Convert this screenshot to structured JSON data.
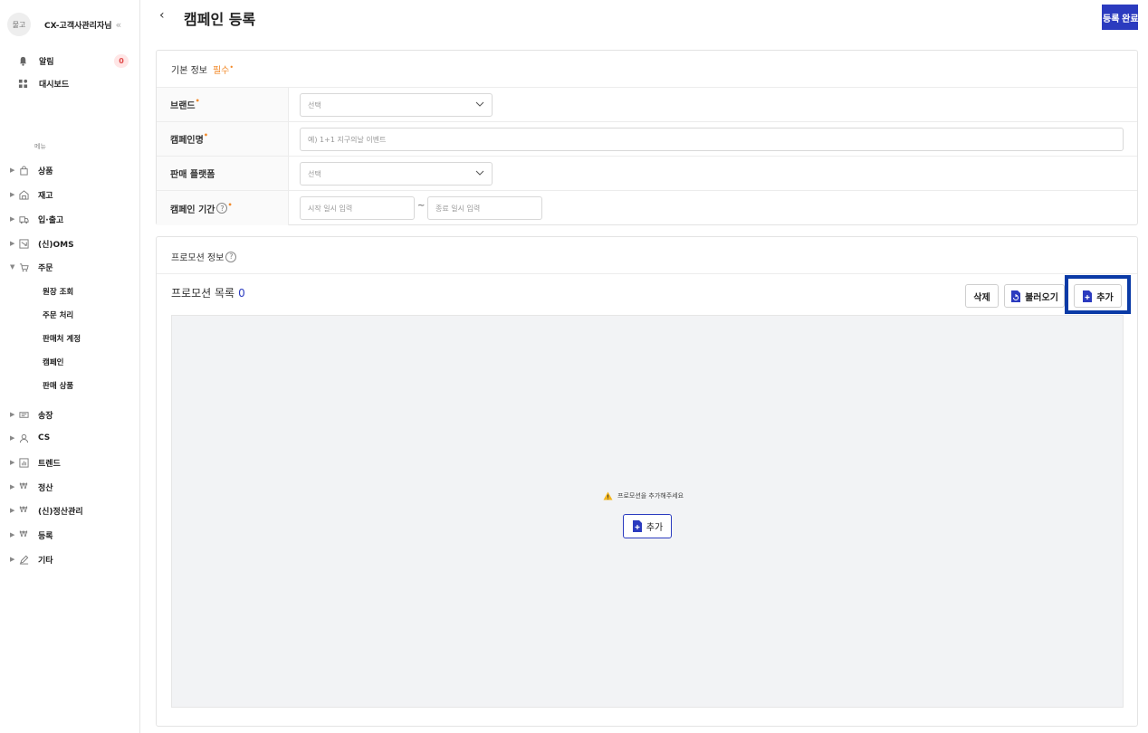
{
  "sidebar": {
    "avatar_text": "물고",
    "user_name": "CX-고객사관리자님",
    "collapse_glyph": "«",
    "top_items": [
      {
        "label": "알림",
        "badge": "0"
      },
      {
        "label": "대시보드"
      }
    ],
    "menu_section": "메뉴",
    "menu": [
      {
        "label": "상품"
      },
      {
        "label": "재고"
      },
      {
        "label": "입·출고"
      },
      {
        "label": "(신)OMS"
      },
      {
        "label": "주문"
      },
      {
        "label": "송장"
      },
      {
        "label": "CS"
      },
      {
        "label": "트렌드"
      },
      {
        "label": "정산"
      },
      {
        "label": "(신)정산관리"
      },
      {
        "label": "등록"
      },
      {
        "label": "기타"
      }
    ],
    "order_sub": [
      "원장 조회",
      "주문 처리",
      "판매처 계정",
      "캠페인",
      "판매 상품"
    ]
  },
  "header": {
    "back_glyph": "‹",
    "title": "캠페인 등록",
    "submit_label": "등록 완료"
  },
  "basic_info": {
    "title": "기본 정보",
    "required_label": "필수",
    "brand_label": "브랜드",
    "brand_placeholder": "선택",
    "campaign_name_label": "캠페인명",
    "campaign_name_placeholder": "예) 1+1 지구의날 이벤트",
    "platform_label": "판매 플랫폼",
    "platform_placeholder": "선택",
    "period_label": "캠페인 기간",
    "start_placeholder": "시작 일시 입력",
    "end_placeholder": "종료 일시 입력",
    "period_separator": "~"
  },
  "promotion": {
    "section_title": "프로모션 정보",
    "list_title": "프로모션 목록",
    "list_count": "0",
    "delete_label": "삭제",
    "import_label": "불러오기",
    "add_label": "추가",
    "empty_message": "프로모션을 추가해주세요",
    "empty_add_label": "추가"
  },
  "colors": {
    "primary": "#2b3bbf",
    "required": "#f28a2a",
    "highlight": "#0a3aa6"
  }
}
